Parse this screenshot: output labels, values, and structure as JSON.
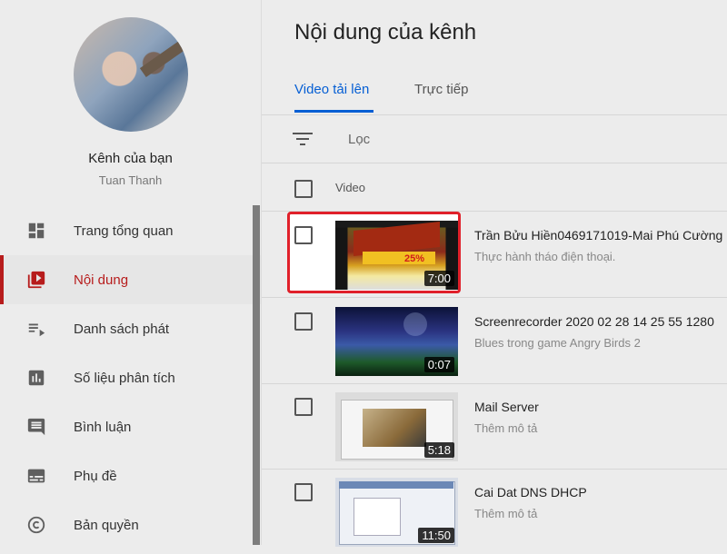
{
  "sidebar": {
    "channel_title": "Kênh của bạn",
    "channel_name": "Tuan Thanh",
    "items": [
      {
        "label": "Trang tổng quan",
        "icon": "dashboard-icon"
      },
      {
        "label": "Nội dung",
        "icon": "video-library-icon",
        "active": true
      },
      {
        "label": "Danh sách phát",
        "icon": "playlist-icon"
      },
      {
        "label": "Số liệu phân tích",
        "icon": "analytics-icon"
      },
      {
        "label": "Bình luận",
        "icon": "comment-icon"
      },
      {
        "label": "Phụ đề",
        "icon": "subtitles-icon"
      },
      {
        "label": "Bản quyền",
        "icon": "copyright-icon"
      }
    ]
  },
  "main": {
    "title": "Nội dung của kênh",
    "tabs": [
      "Video tải lên",
      "Trực tiếp"
    ],
    "filter_label": "Lọc",
    "column_video": "Video",
    "videos": [
      {
        "title": "Trần Bửu Hiền0469171019-Mai Phú Cường",
        "description": "Thực hành tháo điện thoại.",
        "duration": "7:00",
        "thumb_text": "25%"
      },
      {
        "title": "Screenrecorder 2020 02 28 14 25 55 1280",
        "description": "Blues trong game Angry Birds 2",
        "duration": "0:07"
      },
      {
        "title": "Mail Server",
        "description": "Thêm mô tả",
        "duration": "5:18"
      },
      {
        "title": "Cai Dat DNS DHCP",
        "description": "Thêm mô tả",
        "duration": "11:50"
      }
    ]
  },
  "colors": {
    "accent": "#065fd4",
    "active_nav": "#b71c1c",
    "highlight_border": "#e0202a"
  }
}
